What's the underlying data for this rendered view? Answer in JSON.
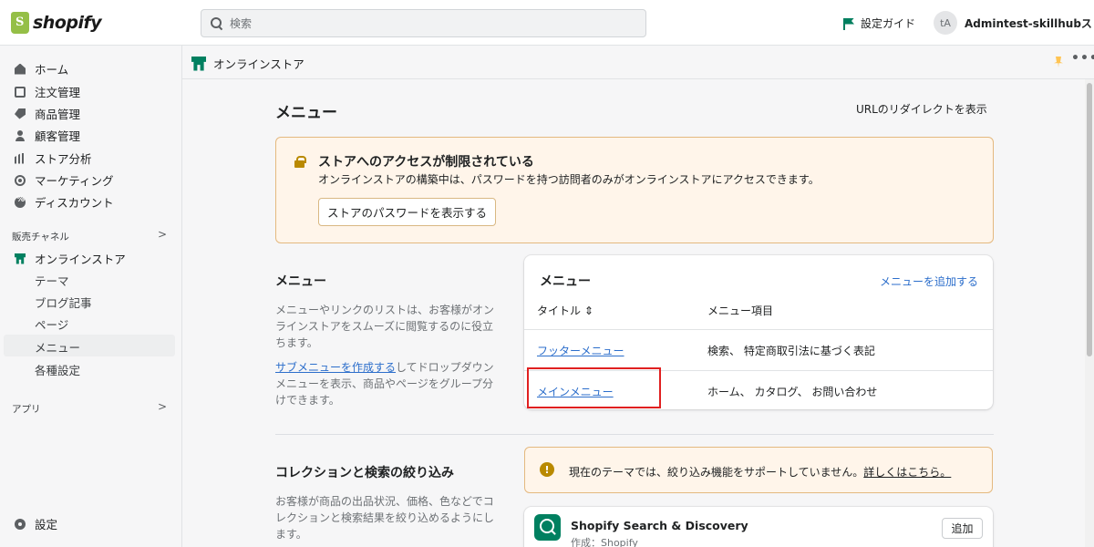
{
  "topbar": {
    "logo_text": "shopify",
    "search_placeholder": "検索",
    "setup_guide": "設定ガイド",
    "avatar_initials": "tA",
    "user_name": "Admintest-skillhubスト..."
  },
  "sidebar": {
    "items": [
      {
        "label": "ホーム",
        "icon": "home-icon"
      },
      {
        "label": "注文管理",
        "icon": "orders-icon"
      },
      {
        "label": "商品管理",
        "icon": "tag-icon"
      },
      {
        "label": "顧客管理",
        "icon": "person-icon"
      },
      {
        "label": "ストア分析",
        "icon": "bar-chart-icon"
      },
      {
        "label": "マーケティング",
        "icon": "target-icon"
      },
      {
        "label": "ディスカウント",
        "icon": "discount-icon"
      }
    ],
    "sales_channels_label": "販売チャネル",
    "online_store": "オンラインストア",
    "sub_items": [
      "テーマ",
      "ブログ記事",
      "ページ",
      "メニュー",
      "各種設定"
    ],
    "apps_label": "アプリ",
    "settings": "設定"
  },
  "channel_bar": {
    "title": "オンラインストア"
  },
  "page": {
    "title": "メニュー",
    "redirect_link": "URLのリダイレクトを表示",
    "banner": {
      "title": "ストアへのアクセスが制限されている",
      "text": "オンラインストアの構築中は、パスワードを持つ訪問者のみがオンラインストアにアクセスできます。",
      "button": "ストアのパスワードを表示する"
    },
    "menu_section": {
      "title": "メニュー",
      "desc": "メニューやリンクのリストは、お客様がオンラインストアをスムーズに閲覧するのに役立ちます。",
      "sub_link": "サブメニューを作成する",
      "sub_desc": "してドロップダウンメニューを表示、商品やページをグループ分けできます。"
    },
    "menu_card": {
      "title": "メニュー",
      "add_link": "メニューを追加する",
      "col_title": "タイトル ⇕",
      "col_items": "メニュー項目",
      "rows": [
        {
          "title": "フッターメニュー",
          "items": "検索、 特定商取引法に基づく表記"
        },
        {
          "title": "メインメニュー",
          "items": "ホーム、 カタログ、 お問い合わせ"
        }
      ]
    },
    "filter_section": {
      "title": "コレクションと検索の絞り込み",
      "desc": "お客様が商品の出品状況、価格、色などでコレクションと検索結果を絞り込めるようにします。"
    },
    "filter_warning": {
      "text": "現在のテーマでは、絞り込み機能をサポートしていません。",
      "link": "詳しくはこちら。"
    },
    "app": {
      "name": "Shopify Search & Discovery",
      "author": "作成：Shopify",
      "button": "追加"
    }
  }
}
